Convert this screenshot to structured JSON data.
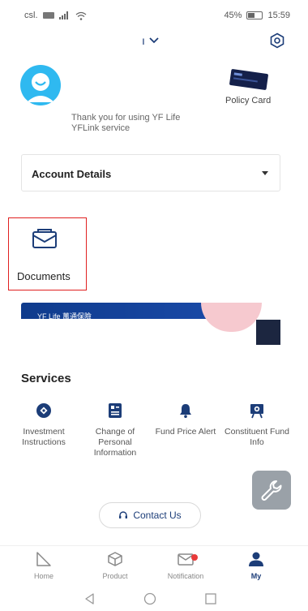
{
  "status": {
    "carrier": "csl.",
    "battery": "45%",
    "time": "15:59"
  },
  "header": {
    "dropdown_text": "ı"
  },
  "profile": {
    "thanks": "Thank you for using YF Life YFLink service"
  },
  "policy_card": {
    "label": "Policy Card"
  },
  "account": {
    "label": "Account Details"
  },
  "documents": {
    "label": "Documents"
  },
  "banner": {
    "text": "YF Life 萬通保險"
  },
  "services": {
    "title": "Services",
    "items": [
      {
        "label": "Investment Instructions"
      },
      {
        "label": "Change of Personal Information"
      },
      {
        "label": "Fund Price Alert"
      },
      {
        "label": "Constituent Fund Info"
      }
    ]
  },
  "contact": {
    "label": "Contact Us"
  },
  "nav": {
    "items": [
      {
        "label": "Home"
      },
      {
        "label": "Product"
      },
      {
        "label": "Notification"
      },
      {
        "label": "My"
      }
    ]
  },
  "colors": {
    "brand": "#1c3d78",
    "accent": "#2fb9f0",
    "highlight": "#e02020",
    "notification": "#e83a3a"
  }
}
